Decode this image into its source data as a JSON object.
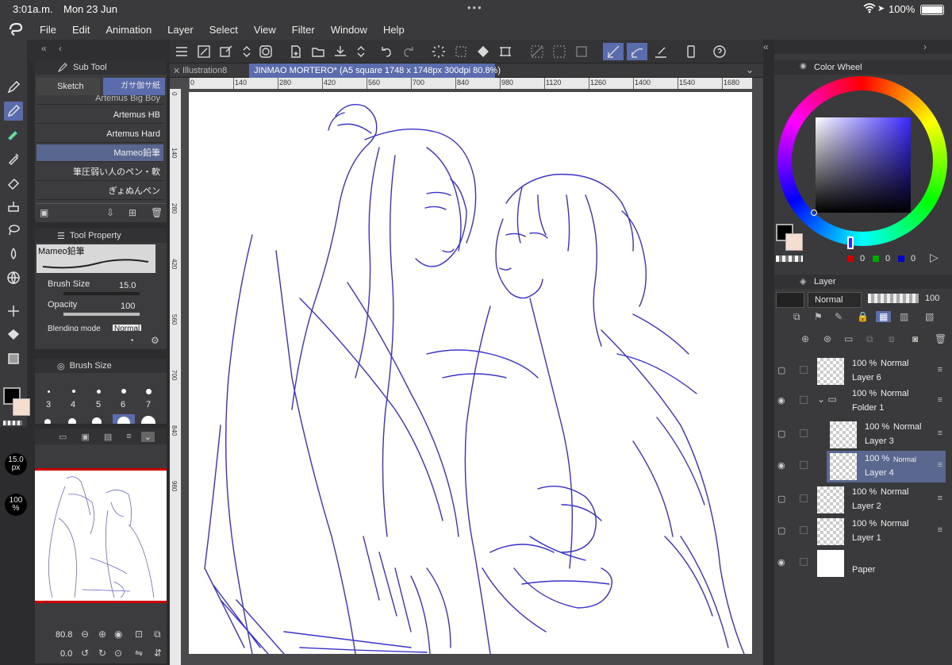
{
  "status": {
    "time": "3:01a.m.",
    "date": "Mon 23 Jun",
    "battery": "100%",
    "dots": "•••"
  },
  "menu": [
    "File",
    "Edit",
    "Animation",
    "Layer",
    "Select",
    "View",
    "Filter",
    "Window",
    "Help"
  ],
  "tabs": {
    "first": "Illustration8",
    "active": "JINMAO MORTERO* (A5 square 1748 x 1748px 300dpi 80.8%)"
  },
  "ruler_ticks": [
    "0",
    "140",
    "280",
    "420",
    "560",
    "700",
    "840",
    "980",
    "1120",
    "1260",
    "1400",
    "1540",
    "1680"
  ],
  "ruler_left_ticks": [
    "0",
    "140",
    "280",
    "420",
    "560",
    "700",
    "840",
    "980"
  ],
  "subtool": {
    "title": "Sub Tool",
    "tab_sketch": "Sketch",
    "tab_other": "ガサ伽サ紙",
    "brushes": [
      "Artemus Big Boy",
      "Artemus HB",
      "Artemus Hard",
      "Mameo鉛筆",
      "筆圧弱い人のペン・軟",
      "ぎょぬんペン"
    ]
  },
  "toolprop": {
    "title": "Tool Property",
    "preset": "Mameo鉛筆",
    "brush_size_label": "Brush Size",
    "brush_size_value": "15.0",
    "opacity_label": "Opacity",
    "opacity_value": "100",
    "blend_label": "Blending mode",
    "blend_value": "Normal"
  },
  "brushsize_panel": {
    "title": "Brush Size",
    "sizes": [
      "3",
      "4",
      "5",
      "6",
      "7"
    ]
  },
  "side_indicators": {
    "size_value": "15.0",
    "size_unit": "px",
    "opacity_value": "100",
    "opacity_unit": "%"
  },
  "navigator": {
    "zoom": "80.8",
    "angle": "0.0"
  },
  "colorwheel": {
    "title": "Color Wheel",
    "r": "0",
    "g": "0",
    "b": "0"
  },
  "layerpanel": {
    "title": "Layer",
    "blend": "Normal",
    "opacity": "100"
  },
  "layers": [
    {
      "pct": "100 %",
      "mode": "Normal",
      "name": "Layer 6",
      "visible": false,
      "selected": false
    },
    {
      "pct": "100 %",
      "mode": "Normal",
      "name": "Folder 1",
      "visible": true,
      "selected": false
    },
    {
      "pct": "100 %",
      "mode": "Normal",
      "name": "Layer 3",
      "visible": false,
      "selected": false
    },
    {
      "pct": "100 %",
      "mode": "Normal",
      "name": "Layer 4",
      "visible": true,
      "selected": true
    },
    {
      "pct": "100 %",
      "mode": "Normal",
      "name": "Layer 2",
      "visible": false,
      "selected": false
    },
    {
      "pct": "100 %",
      "mode": "Normal",
      "name": "Layer 1",
      "visible": false,
      "selected": false
    },
    {
      "pct": "",
      "mode": "",
      "name": "Paper",
      "visible": true,
      "selected": false
    }
  ],
  "colors": {
    "accent": "#5b6cad",
    "sketch_line": "#3a32c8",
    "main_color": "#000000",
    "sub_color": "#f5ddd0"
  }
}
